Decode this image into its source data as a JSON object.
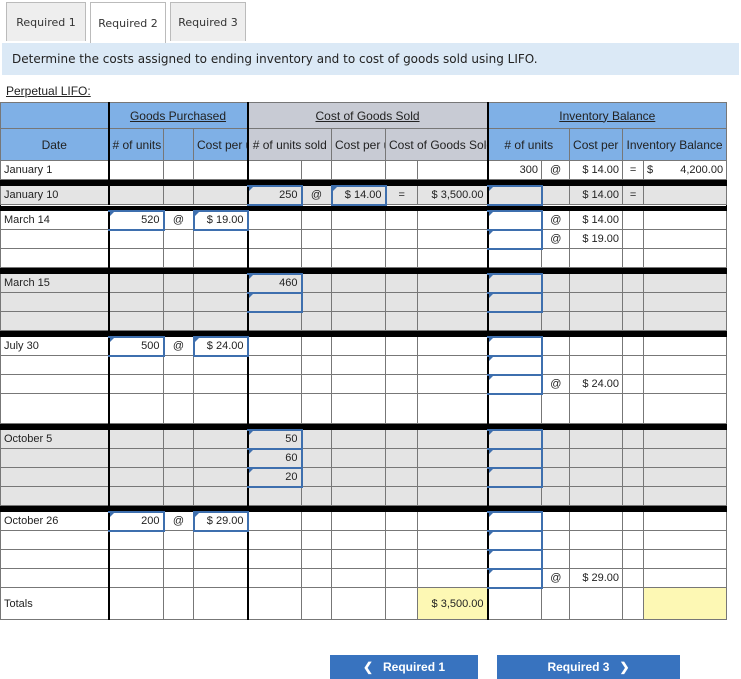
{
  "tabs": [
    {
      "label": "Required 1",
      "active": false
    },
    {
      "label": "Required 2",
      "active": true
    },
    {
      "label": "Required 3",
      "active": false
    }
  ],
  "instruction": "Determine the costs assigned to ending inventory and to cost of goods sold using LIFO.",
  "section_title": "Perpetual LIFO:",
  "headers": {
    "goods_purchased": "Goods Purchased",
    "cost_of_goods_sold": "Cost of Goods Sold",
    "inventory_balance": "Inventory Balance",
    "date": "Date",
    "gp_units": "# of units",
    "gp_cost": "Cost per unit",
    "cogs_units": "# of units sold",
    "cogs_cost": "Cost per unit",
    "cogs_total": "Cost of Goods Sold",
    "ib_units": "# of units",
    "ib_cost": "Cost per unit",
    "ib_balance": "Inventory Balance"
  },
  "symbols": {
    "at": "@",
    "eq": "=",
    "dollar": "$"
  },
  "rows": {
    "jan1": {
      "date": "January 1",
      "ib_units": "300",
      "ib_cost": "$ 14.00",
      "ib_balance": "4,200.00"
    },
    "jan10": {
      "date": "January 10",
      "cogs_units": "250",
      "cogs_cost": "$ 14.00",
      "cogs_total": "$ 3,500.00",
      "ib_units": "",
      "ib_cost": "$ 14.00",
      "ib_balance": ""
    },
    "mar14": {
      "date": "March 14",
      "gp_units": "520",
      "gp_cost": "$ 19.00",
      "ib_cost_1": "$ 14.00",
      "ib_cost_2": "$ 19.00"
    },
    "mar15": {
      "date": "March 15",
      "cogs_units_1": "460",
      "cogs_units_2": ""
    },
    "jul30": {
      "date": "July 30",
      "gp_units": "500",
      "gp_cost": "$ 24.00",
      "ib_cost_3": "$ 24.00"
    },
    "oct5": {
      "date": "October 5",
      "cogs_units_1": "50",
      "cogs_units_2": "60",
      "cogs_units_3": "20"
    },
    "oct26": {
      "date": "October 26",
      "gp_units": "200",
      "gp_cost": "$ 29.00",
      "ib_cost_4": "$ 29.00"
    },
    "totals": {
      "label": "Totals",
      "cogs_total": "$ 3,500.00",
      "ib_balance": ""
    }
  },
  "nav": {
    "prev_label": "Required 1",
    "next_label": "Required 3",
    "prev_icon": "chevron-left-icon",
    "next_icon": "chevron-right-icon"
  }
}
